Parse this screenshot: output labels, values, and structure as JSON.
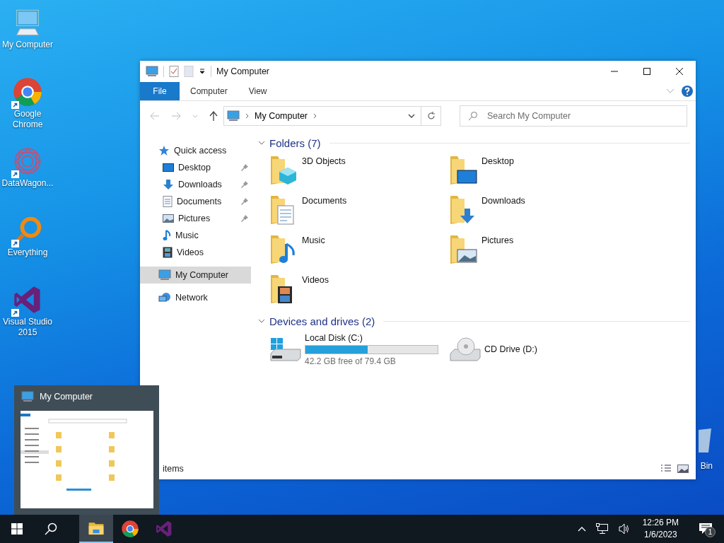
{
  "desktop_icons": [
    {
      "label": "My Computer",
      "kind": "computer",
      "shortcut": false
    },
    {
      "label": "Google Chrome",
      "kind": "chrome",
      "shortcut": true
    },
    {
      "label": "DataWagon...",
      "kind": "datawagon",
      "shortcut": true
    },
    {
      "label": "Everything",
      "kind": "everything",
      "shortcut": true
    },
    {
      "label": "Visual Studio 2015",
      "kind": "vs",
      "shortcut": true
    }
  ],
  "recycle_bin": {
    "label": "Bin"
  },
  "window": {
    "title": "My Computer",
    "ribbon_tabs": [
      {
        "label": "File",
        "selected": true
      },
      {
        "label": "Computer",
        "selected": false
      },
      {
        "label": "View",
        "selected": false
      }
    ],
    "address": {
      "path": "My Computer"
    },
    "search": {
      "placeholder": "Search My Computer"
    },
    "nav": [
      {
        "label": "Quick access",
        "kind": "quick",
        "selected": false,
        "children": [
          {
            "label": "Desktop",
            "kind": "desktop",
            "pinned": true,
            "selected": false
          },
          {
            "label": "Downloads",
            "kind": "downloads",
            "pinned": true,
            "selected": false
          },
          {
            "label": "Documents",
            "kind": "documents",
            "pinned": true,
            "selected": false
          },
          {
            "label": "Pictures",
            "kind": "pictures",
            "pinned": true,
            "selected": false
          },
          {
            "label": "Music",
            "kind": "music",
            "pinned": false,
            "selected": false
          },
          {
            "label": "Videos",
            "kind": "videos",
            "pinned": false,
            "selected": false
          }
        ]
      },
      {
        "label": "My Computer",
        "kind": "computer",
        "selected": true
      },
      {
        "label": "Network",
        "kind": "network",
        "selected": false
      }
    ],
    "folders": {
      "title": "Folders (7)",
      "expanded": true,
      "items": [
        {
          "label": "3D Objects",
          "kind": "objects"
        },
        {
          "label": "Desktop",
          "kind": "desktop"
        },
        {
          "label": "Documents",
          "kind": "documents"
        },
        {
          "label": "Downloads",
          "kind": "downloads"
        },
        {
          "label": "Music",
          "kind": "music"
        },
        {
          "label": "Pictures",
          "kind": "pictures"
        },
        {
          "label": "Videos",
          "kind": "videos"
        }
      ]
    },
    "drives": {
      "title": "Devices and drives (2)",
      "expanded": true,
      "items": [
        {
          "label": "Local Disk (C:)",
          "kind": "disk",
          "level": 0.47,
          "free": "42.2 GB free of 79.4 GB"
        },
        {
          "label": "CD Drive (D:)",
          "kind": "cd"
        }
      ]
    },
    "status_bar": {
      "text": "items"
    }
  },
  "preview": {
    "title": "My Computer"
  },
  "taskbar": {
    "apps": [
      {
        "kind": "explorer",
        "active": true
      },
      {
        "kind": "chrome",
        "active": false
      },
      {
        "kind": "vs",
        "active": false
      }
    ],
    "clock": {
      "time": "12:26 PM",
      "date": "1/6/2023"
    },
    "notifications": "1"
  }
}
